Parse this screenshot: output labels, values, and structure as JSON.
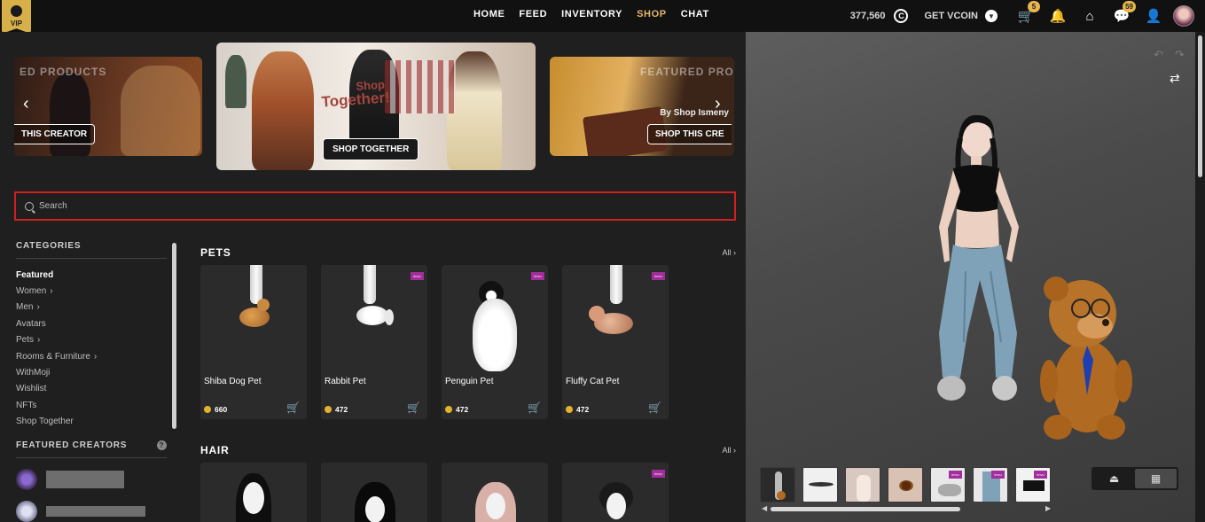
{
  "nav": {
    "vip_label": "VIP",
    "links": [
      "HOME",
      "FEED",
      "INVENTORY",
      "SHOP",
      "CHAT"
    ],
    "active": "SHOP",
    "credits": "377,560",
    "credit_icon": "C",
    "get_vcoin": "GET VCOIN",
    "cart_count": "5",
    "messages_count": "59"
  },
  "banners": {
    "left": {
      "title": "ED PRODUCTS",
      "button": "THIS CREATOR"
    },
    "center": {
      "headline_1": "Shop",
      "headline_2": "Together!",
      "button": "SHOP TOGETHER"
    },
    "right": {
      "title": "FEATURED PRO",
      "subtitle": "By Shop Ismeny",
      "button": "SHOP THIS CRE"
    }
  },
  "search": {
    "placeholder": "Search"
  },
  "categories": {
    "title": "CATEGORIES",
    "items": [
      {
        "label": "Featured",
        "selected": true,
        "chevron": false
      },
      {
        "label": "Women",
        "chevron": true
      },
      {
        "label": "Men",
        "chevron": true
      },
      {
        "label": "Avatars",
        "chevron": false
      },
      {
        "label": "Pets",
        "chevron": true
      },
      {
        "label": "Rooms & Furniture",
        "chevron": true
      },
      {
        "label": "WithMoji",
        "chevron": false
      },
      {
        "label": "Wishlist",
        "chevron": false
      },
      {
        "label": "NFTs",
        "chevron": false
      },
      {
        "label": "Shop Together",
        "chevron": false
      }
    ]
  },
  "featured_creators": {
    "title": "FEATURED CREATORS",
    "help": "?"
  },
  "pets": {
    "title": "PETS",
    "all": "All",
    "items": [
      {
        "name": "Shiba Dog Pet",
        "price": "660",
        "tag": false
      },
      {
        "name": "Rabbit Pet",
        "price": "472",
        "tag": true
      },
      {
        "name": "Penguin Pet",
        "price": "472",
        "tag": true
      },
      {
        "name": "Fluffy Cat Pet",
        "price": "472",
        "tag": true
      }
    ]
  },
  "hair": {
    "title": "HAIR",
    "all": "All"
  },
  "colors": {
    "accent": "#e3b46c",
    "highlight_border": "#d02020",
    "coin": "#e3b22b",
    "tag": "#a22d9c"
  }
}
